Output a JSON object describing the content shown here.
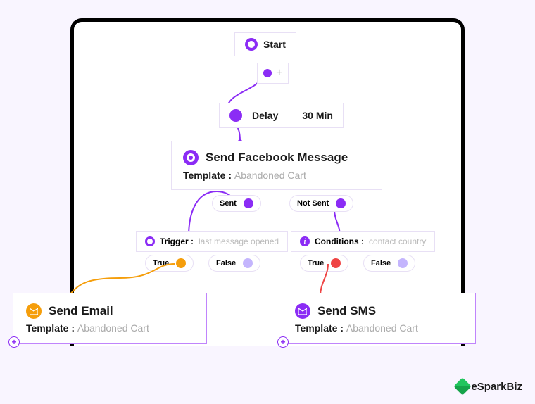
{
  "start": {
    "label": "Start"
  },
  "plus": {
    "symbol": "+"
  },
  "delay": {
    "label": "Delay",
    "value": "30 Min"
  },
  "facebook": {
    "title": "Send Facebook Message",
    "template_label": "Template :",
    "template_value": "Abandoned Cart"
  },
  "branches": {
    "sent": "Sent",
    "not_sent": "Not Sent"
  },
  "trigger": {
    "label": "Trigger :",
    "value": "last message opened"
  },
  "conditions": {
    "label": "Conditions :",
    "value": "contact country"
  },
  "bool": {
    "true": "True",
    "false": "False"
  },
  "email": {
    "title": "Send Email",
    "template_label": "Template :",
    "template_value": "Abandoned Cart"
  },
  "sms": {
    "title": "Send SMS",
    "template_label": "Template :",
    "template_value": "Abandoned Cart"
  },
  "brand": "eSparkBiz"
}
